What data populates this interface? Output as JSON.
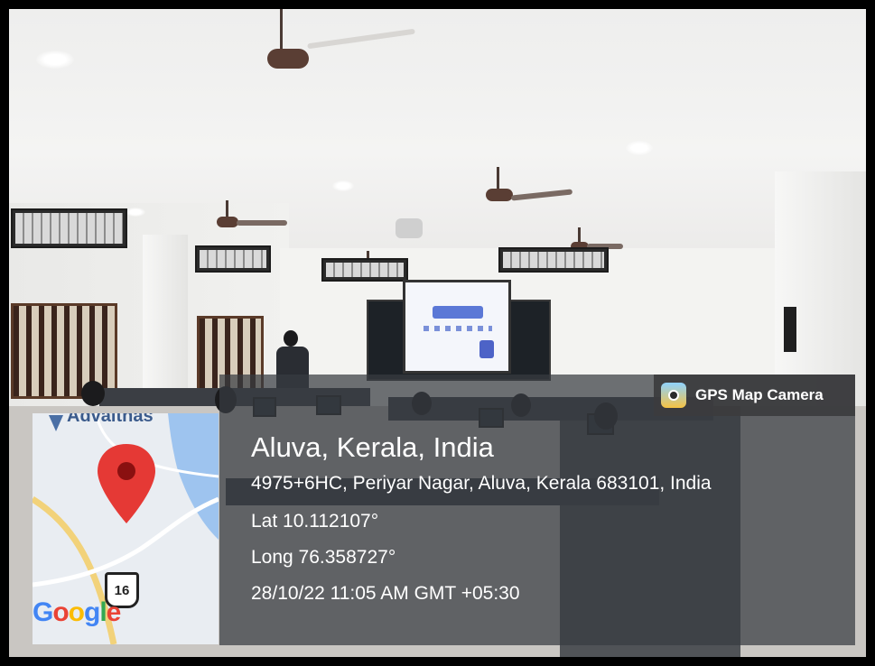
{
  "app": {
    "name": "GPS Map Camera"
  },
  "location": {
    "title": "Aluva, Kerala, India",
    "address": "4975+6HC, Periyar Nagar, Aluva, Kerala 683101, India",
    "latitude": "Lat 10.112107°",
    "longitude": "Long 76.358727°",
    "datetime": "28/10/22 11:05 AM GMT +05:30"
  },
  "map": {
    "place_label": "Advaithas",
    "route_number": "16",
    "logo_text": "Google",
    "colors": {
      "pin": "#e53935",
      "road": "#f2d27a",
      "water": "#9ec4ef"
    }
  },
  "colors": {
    "overlay": "#373c41",
    "badge_icon": "#f6c343"
  }
}
